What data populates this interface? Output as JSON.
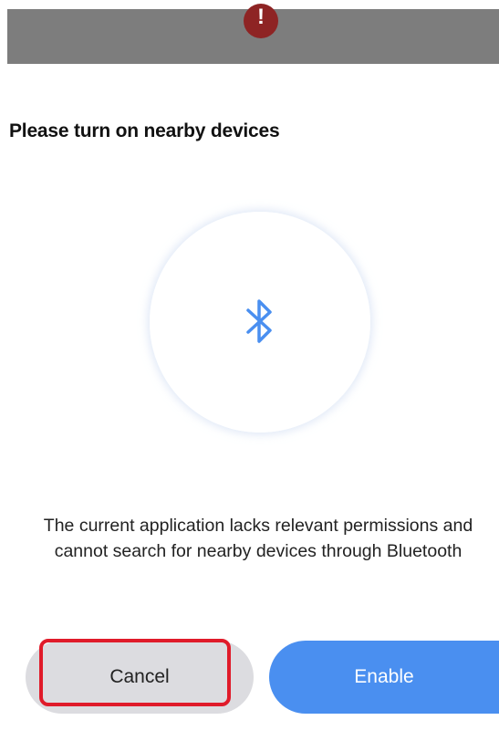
{
  "backdrop": {
    "alert_icon": "!",
    "alert_icon_name": "alert-icon",
    "alert_color": "#8e2424"
  },
  "dialog": {
    "title": "Please turn on nearby devices",
    "illustration_icon": "bluetooth-icon",
    "description": "The current application lacks relevant permissions and cannot search for nearby devices through Bluetooth",
    "buttons": {
      "cancel_label": "Cancel",
      "enable_label": "Enable"
    }
  },
  "colors": {
    "accent": "#4a8ff0",
    "cancel_bg": "#dcdce0",
    "highlight": "#e01b2a"
  }
}
